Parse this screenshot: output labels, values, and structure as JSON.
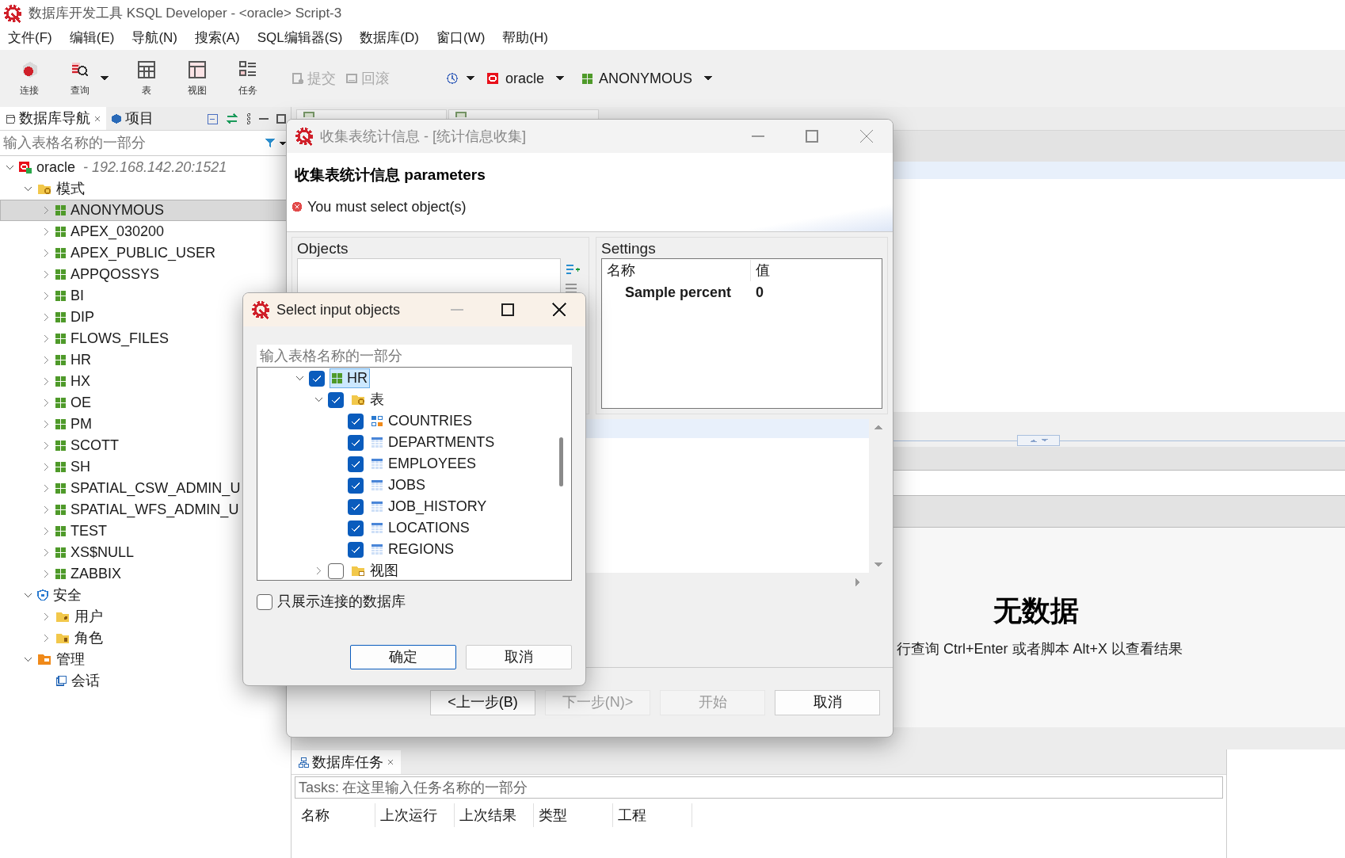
{
  "window": {
    "title": "数据库开发工具 KSQL Developer - <oracle> Script-3"
  },
  "menu": [
    {
      "label": "文件(F)"
    },
    {
      "label": "编辑(E)"
    },
    {
      "label": "导航(N)"
    },
    {
      "label": "搜索(A)"
    },
    {
      "label": "SQL编辑器(S)"
    },
    {
      "label": "数据库(D)"
    },
    {
      "label": "窗口(W)"
    },
    {
      "label": "帮助(H)"
    }
  ],
  "toolbar": {
    "buttons": [
      {
        "label": "连接",
        "kind": "connect",
        "dropdown": false
      },
      {
        "label": "查询",
        "kind": "query",
        "dropdown": true
      },
      {
        "label": "表",
        "kind": "table",
        "dropdown": false
      },
      {
        "label": "视图",
        "kind": "view",
        "dropdown": false
      },
      {
        "label": "任务",
        "kind": "tasks",
        "dropdown": false
      }
    ],
    "actions": [
      {
        "label": "提交",
        "kind": "commit",
        "disabled": true
      },
      {
        "label": "回滚",
        "kind": "rollback",
        "disabled": true
      }
    ],
    "connection": "oracle",
    "schema": "ANONYMOUS"
  },
  "navigator": {
    "tabs": [
      {
        "label": "数据库导航",
        "selected": true
      },
      {
        "label": "项目",
        "selected": false
      }
    ],
    "filter_placeholder": "输入表格名称的一部分",
    "tree": [
      {
        "label": "oracle",
        "detail": "- 192.168.142.20:1521",
        "kind": "connection",
        "expanded": true,
        "selected": false,
        "children": [
          {
            "label": "模式",
            "kind": "folder",
            "expanded": true,
            "selected": false,
            "children": [
              {
                "label": "ANONYMOUS",
                "kind": "schema",
                "expanded": false,
                "selected": true
              },
              {
                "label": "APEX_030200",
                "kind": "schema",
                "expanded": false,
                "selected": false
              },
              {
                "label": "APEX_PUBLIC_USER",
                "kind": "schema",
                "expanded": false,
                "selected": false
              },
              {
                "label": "APPQOSSYS",
                "kind": "schema",
                "expanded": false,
                "selected": false
              },
              {
                "label": "BI",
                "kind": "schema",
                "expanded": false,
                "selected": false
              },
              {
                "label": "DIP",
                "kind": "schema",
                "expanded": false,
                "selected": false
              },
              {
                "label": "FLOWS_FILES",
                "kind": "schema",
                "expanded": false,
                "selected": false
              },
              {
                "label": "HR",
                "kind": "schema",
                "expanded": false,
                "selected": false
              },
              {
                "label": "HX",
                "kind": "schema",
                "expanded": false,
                "selected": false
              },
              {
                "label": "OE",
                "kind": "schema",
                "expanded": false,
                "selected": false
              },
              {
                "label": "PM",
                "kind": "schema",
                "expanded": false,
                "selected": false
              },
              {
                "label": "SCOTT",
                "kind": "schema",
                "expanded": false,
                "selected": false
              },
              {
                "label": "SH",
                "kind": "schema",
                "expanded": false,
                "selected": false
              },
              {
                "label": "SPATIAL_CSW_ADMIN_U",
                "kind": "schema",
                "expanded": false,
                "selected": false
              },
              {
                "label": "SPATIAL_WFS_ADMIN_U",
                "kind": "schema",
                "expanded": false,
                "selected": false
              },
              {
                "label": "TEST",
                "kind": "schema",
                "expanded": false,
                "selected": false
              },
              {
                "label": "XS$NULL",
                "kind": "schema",
                "expanded": false,
                "selected": false
              },
              {
                "label": "ZABBIX",
                "kind": "schema",
                "expanded": false,
                "selected": false
              }
            ]
          },
          {
            "label": "安全",
            "kind": "security",
            "expanded": true,
            "selected": false,
            "children": [
              {
                "label": "用户",
                "kind": "user-folder",
                "expanded": false,
                "selected": false
              },
              {
                "label": "角色",
                "kind": "role-folder",
                "expanded": false,
                "selected": false
              }
            ]
          },
          {
            "label": "管理",
            "kind": "admin",
            "expanded": true,
            "selected": false,
            "children": [
              {
                "label": "会话",
                "kind": "session",
                "selected": false
              }
            ]
          }
        ]
      }
    ]
  },
  "results": {
    "title": "无数据",
    "hint": "行查询 Ctrl+Enter 或者脚本 Alt+X 以查看结果"
  },
  "tasks_panel": {
    "tab": "数据库任务",
    "filter_label": "Tasks:",
    "filter_placeholder": "在这里输入任务名称的一部分",
    "columns": [
      "名称",
      "上次运行",
      "上次结果",
      "类型",
      "工程"
    ]
  },
  "stats_dialog": {
    "title": "收集表统计信息 - [统计信息收集]",
    "heading": "收集表统计信息 parameters",
    "error": "You must select object(s)",
    "objects_label": "Objects",
    "settings_label": "Settings",
    "settings_columns": [
      "名称",
      "值"
    ],
    "settings_rows": [
      {
        "name": "Sample percent",
        "value": "0"
      }
    ],
    "buttons": [
      {
        "label": "<上一步(B)",
        "disabled": false
      },
      {
        "label": "下一步(N)>",
        "disabled": true
      },
      {
        "label": "开始",
        "disabled": true
      },
      {
        "label": "取消",
        "disabled": false
      }
    ]
  },
  "select_dialog": {
    "title": "Select input objects",
    "filter_placeholder": "输入表格名称的一部分",
    "tree": [
      {
        "label": "HR",
        "kind": "schema",
        "expanded": true,
        "checked": true,
        "selected": true,
        "children": [
          {
            "label": "表",
            "kind": "folder",
            "expanded": true,
            "checked": true,
            "selected": false,
            "children": [
              {
                "label": "COUNTRIES",
                "kind": "index-table",
                "checked": true,
                "selected": false
              },
              {
                "label": "DEPARTMENTS",
                "kind": "table",
                "checked": true,
                "selected": false
              },
              {
                "label": "EMPLOYEES",
                "kind": "table",
                "checked": true,
                "selected": false
              },
              {
                "label": "JOBS",
                "kind": "table",
                "checked": true,
                "selected": false
              },
              {
                "label": "JOB_HISTORY",
                "kind": "table",
                "checked": true,
                "selected": false
              },
              {
                "label": "LOCATIONS",
                "kind": "table",
                "checked": true,
                "selected": false
              },
              {
                "label": "REGIONS",
                "kind": "table",
                "checked": true,
                "selected": false
              }
            ]
          },
          {
            "label": "视图",
            "kind": "view-folder",
            "expanded": false,
            "checked": false,
            "selected": false
          }
        ]
      }
    ],
    "only_connected": {
      "label": "只展示连接的数据库",
      "checked": false
    },
    "buttons": [
      {
        "label": "确定",
        "default": true
      },
      {
        "label": "取消",
        "default": false
      }
    ]
  }
}
